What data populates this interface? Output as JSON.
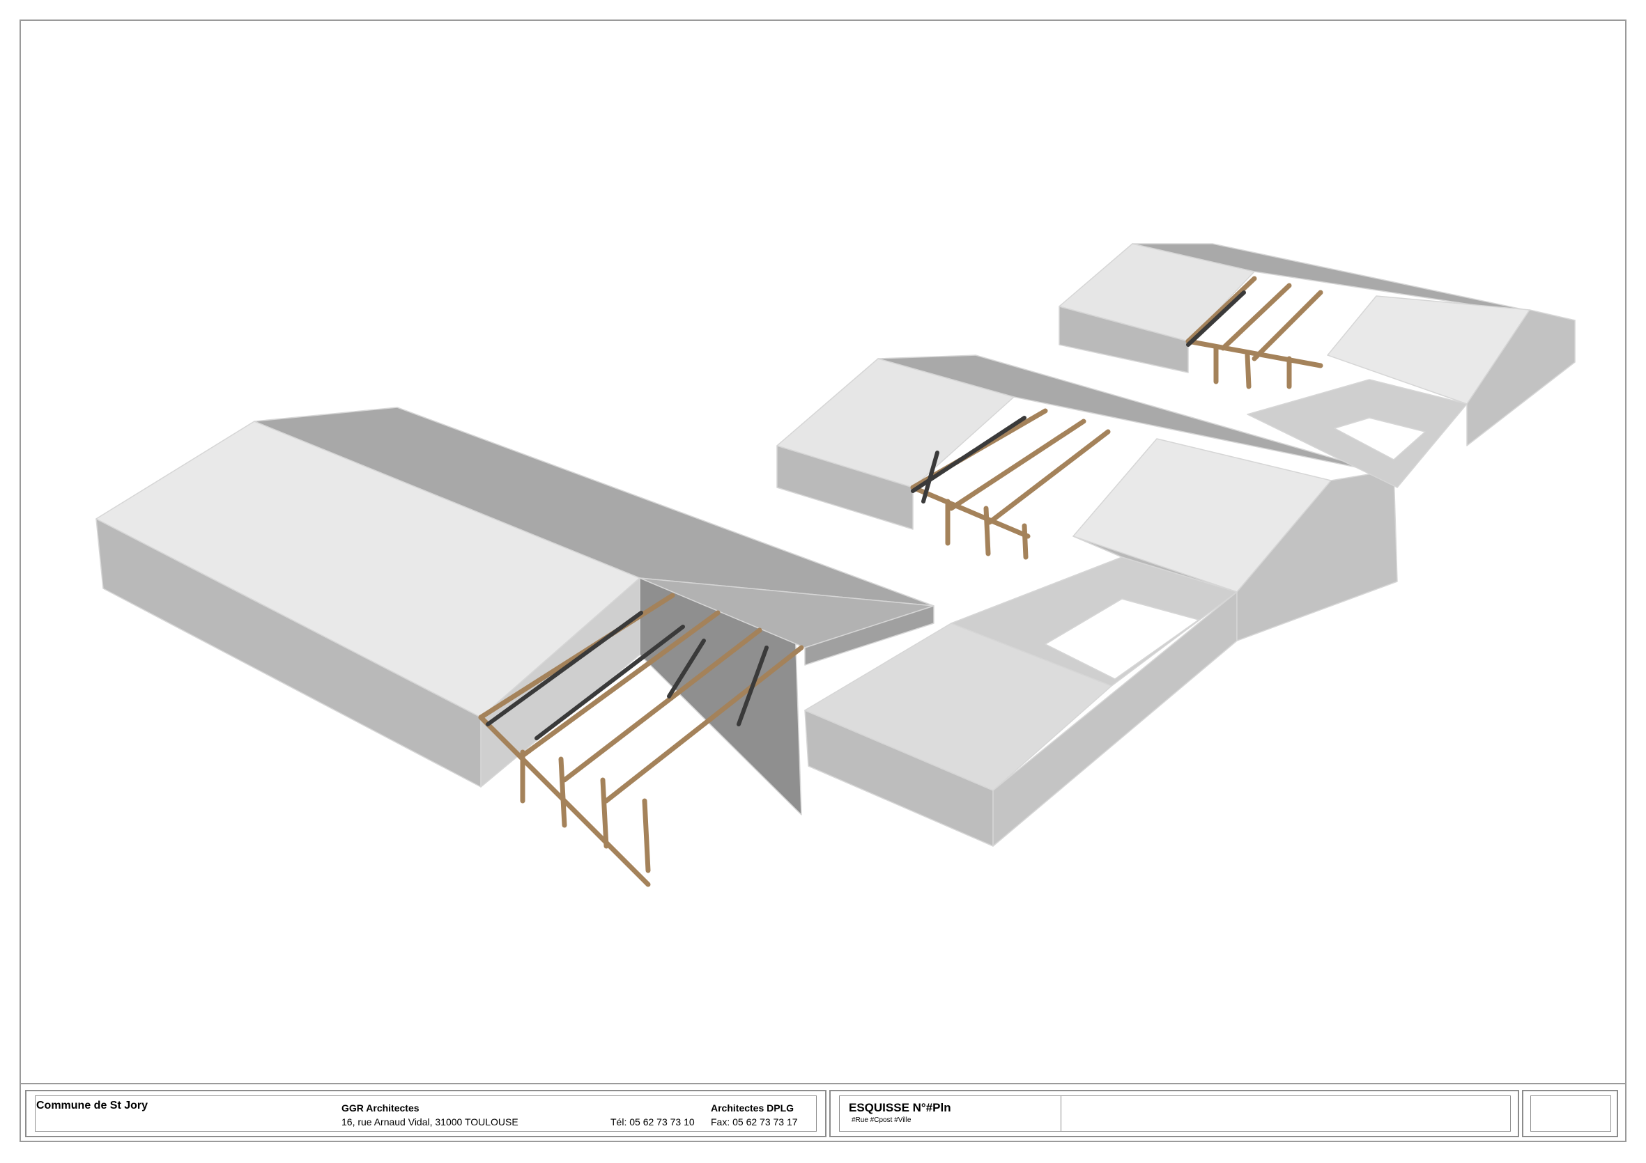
{
  "title_block": {
    "client": "Commune de St Jory",
    "firm_name": "GGR Architectes",
    "firm_address": "16, rue Arnaud Vidal, 31000 TOULOUSE",
    "firm_title": "Architectes DPLG",
    "firm_phone": "Tél: 05 62 73 73 10",
    "firm_fax": "Fax: 05 62 73 73 17",
    "sheet_title": "ESQUISSE N°#Pln",
    "sheet_subtitle": "#Rue #Cpost #Ville"
  },
  "colors": {
    "roof_light": "#e8e8e8",
    "wall_shade": "#bdbdbd",
    "roof_dark": "#a9a9a9",
    "timber": "#a4825a",
    "brace": "#3c3c3c"
  }
}
